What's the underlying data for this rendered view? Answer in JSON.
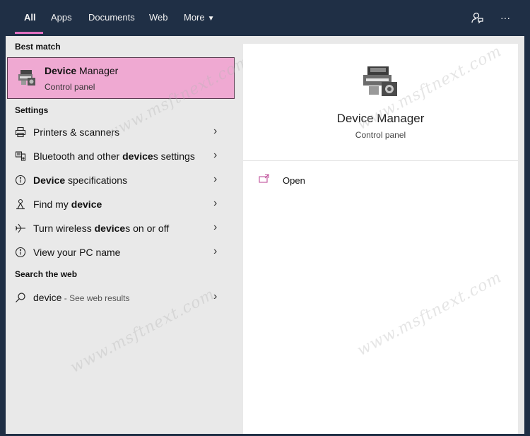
{
  "tabs": [
    {
      "label": "All"
    },
    {
      "label": "Apps"
    },
    {
      "label": "Documents"
    },
    {
      "label": "Web"
    },
    {
      "label": "More"
    }
  ],
  "left": {
    "best_match_heading": "Best match",
    "best_match": {
      "title_bold": "Device",
      "title_rest": " Manager",
      "subtitle": "Control panel"
    },
    "settings_heading": "Settings",
    "settings": [
      {
        "pre": "Printers & scanners",
        "bold": "",
        "post": "",
        "icon": "printer-icon"
      },
      {
        "pre": "Bluetooth and other ",
        "bold": "device",
        "post": "s settings",
        "icon": "bluetooth-devices-icon"
      },
      {
        "pre": "",
        "bold": "Device",
        "post": " specifications",
        "icon": "info-icon"
      },
      {
        "pre": "Find my ",
        "bold": "device",
        "post": "",
        "icon": "find-device-icon"
      },
      {
        "pre": "Turn wireless ",
        "bold": "device",
        "post": "s on or off",
        "icon": "airplane-icon"
      },
      {
        "pre": "View your PC name",
        "bold": "",
        "post": "",
        "icon": "info-icon"
      }
    ],
    "web_heading": "Search the web",
    "web": {
      "query": "device",
      "hint": " - See web results"
    }
  },
  "right": {
    "title": "Device Manager",
    "subtitle": "Control panel",
    "open_label": "Open"
  },
  "watermark": "www.msftnext.com",
  "colors": {
    "accent": "#e070c0",
    "highlight": "#efa9d2",
    "titlebar": "#1f2f45"
  }
}
